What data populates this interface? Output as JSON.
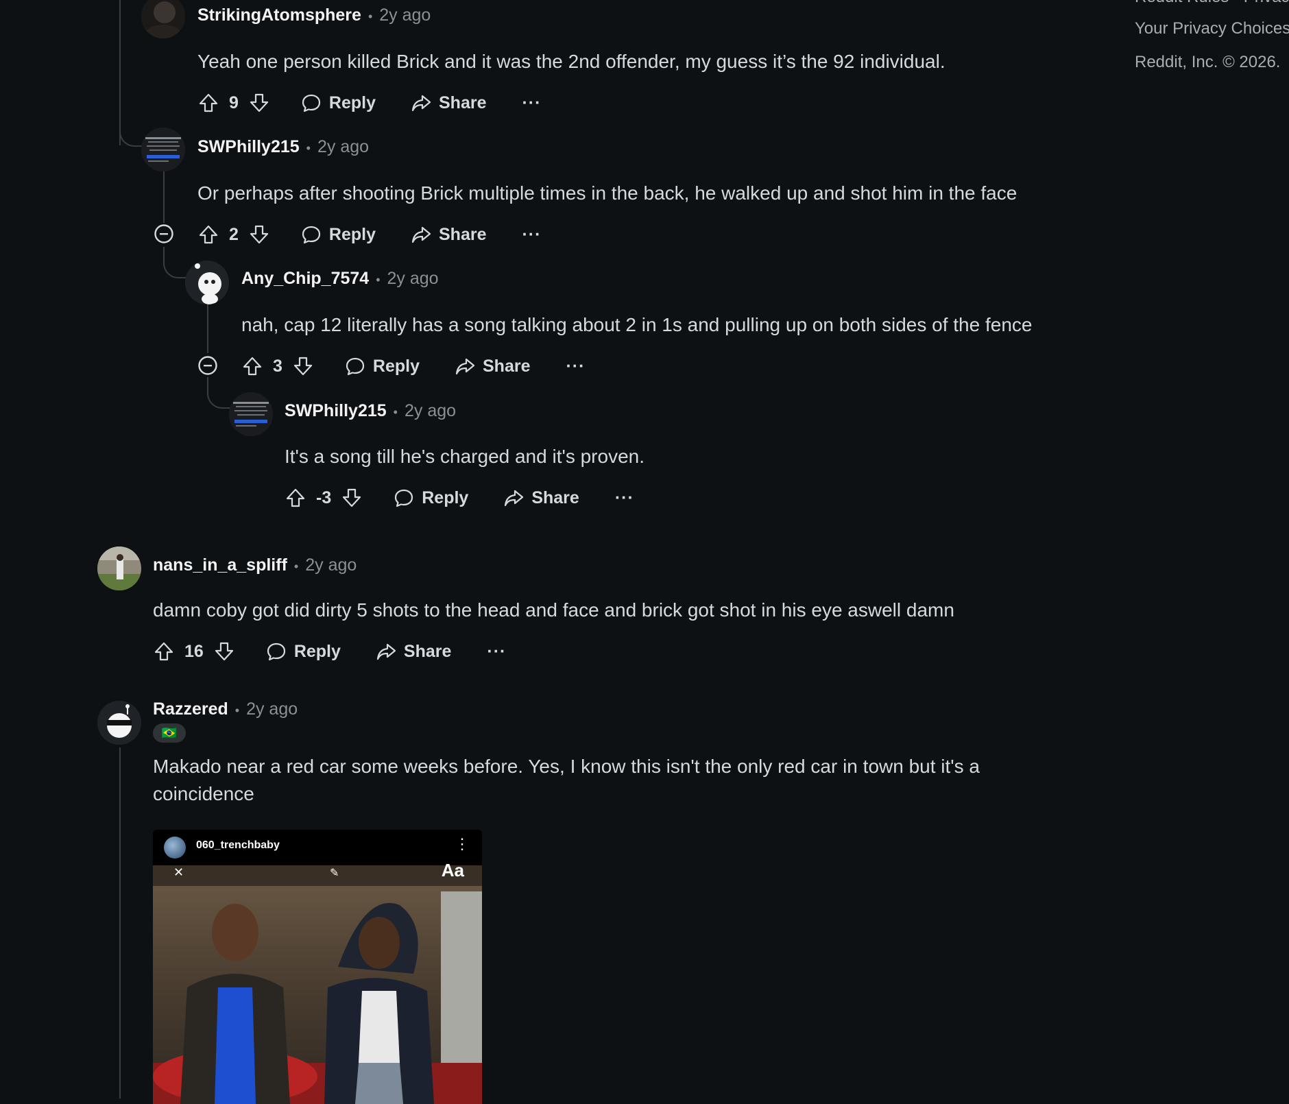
{
  "sidebar": {
    "rules_partial": "Reddit Rules · Privac",
    "privacy": "Your Privacy Choices",
    "copyright": "Reddit, Inc. © 2026."
  },
  "labels": {
    "reply": "Reply",
    "share": "Share",
    "more": "···"
  },
  "comments": [
    {
      "author": "StrikingAtomsphere",
      "time": "2y ago",
      "sep": "•",
      "body": "Yeah one person killed Brick and it was the 2nd offender, my guess it’s the 92 individual.",
      "score": "9"
    },
    {
      "author": "SWPhilly215",
      "time": "2y ago",
      "sep": "•",
      "body": "Or perhaps after shooting Brick multiple times in the back, he walked up and shot him in the face",
      "score": "2"
    },
    {
      "author": "Any_Chip_7574",
      "time": "2y ago",
      "sep": "•",
      "body": "nah, cap 12 literally has a song talking about 2 in 1s and pulling up on both sides of the fence",
      "score": "3"
    },
    {
      "author": "SWPhilly215",
      "time": "2y ago",
      "sep": "•",
      "body": "It's a song till he's charged and it's proven.",
      "score": "-3"
    },
    {
      "author": "nans_in_a_spliff",
      "time": "2y ago",
      "sep": "•",
      "body": "damn coby got did dirty 5 shots to the head and face and brick got shot in his eye aswell damn",
      "score": "16"
    },
    {
      "author": "Razzered",
      "time": "2y ago",
      "sep": "•",
      "body": "Makado near a red car some weeks before. Yes, I know this isn't the only red car in town but it's a coincidence",
      "flair": "🇧🇷"
    }
  ],
  "embed": {
    "username": "060_trenchbaby",
    "overlay_text": "Aa"
  },
  "colors": {
    "background": "#0e1113",
    "text": "#d7dadc",
    "muted": "#8b9094",
    "thread": "#3a3d40"
  }
}
